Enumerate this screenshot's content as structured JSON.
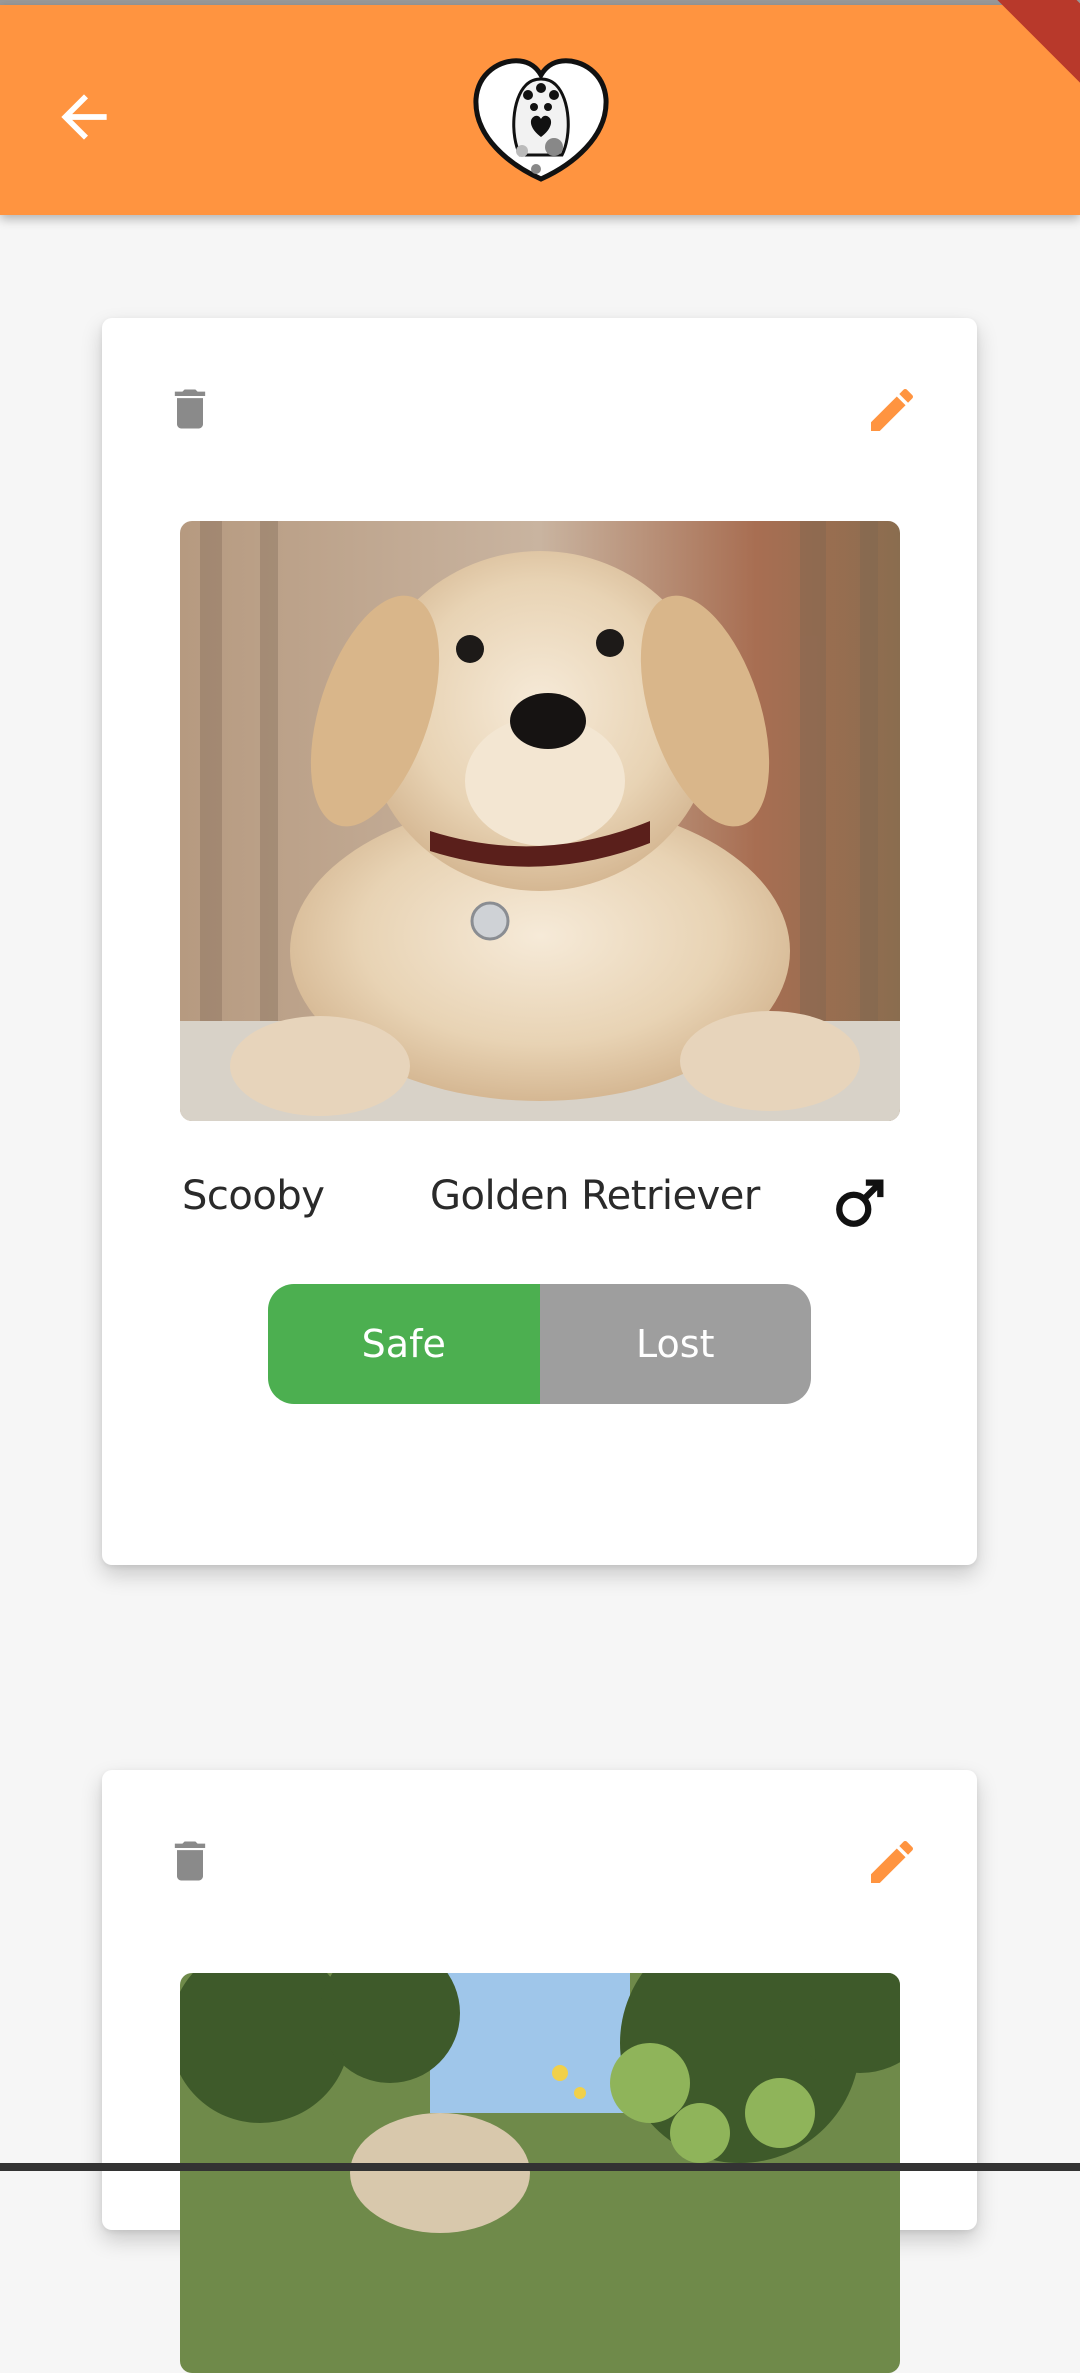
{
  "colors": {
    "app_bar": "#ff9440",
    "accent_edit": "#ff9440",
    "safe": "#4caf50",
    "lost": "#9e9e9e",
    "trash": "#8a8a8a"
  },
  "header": {
    "back_icon": "arrow-back-icon",
    "logo_icon": "heart-paw-logo-icon"
  },
  "pets": [
    {
      "name": "Scooby",
      "breed": "Golden Retriever",
      "gender_icon": "male-icon",
      "status_options": [
        "Safe",
        "Lost"
      ],
      "selected_status": "Safe",
      "photo": "golden-retriever-puppy-photo"
    },
    {
      "photo": "dog-in-garden-photo"
    }
  ]
}
